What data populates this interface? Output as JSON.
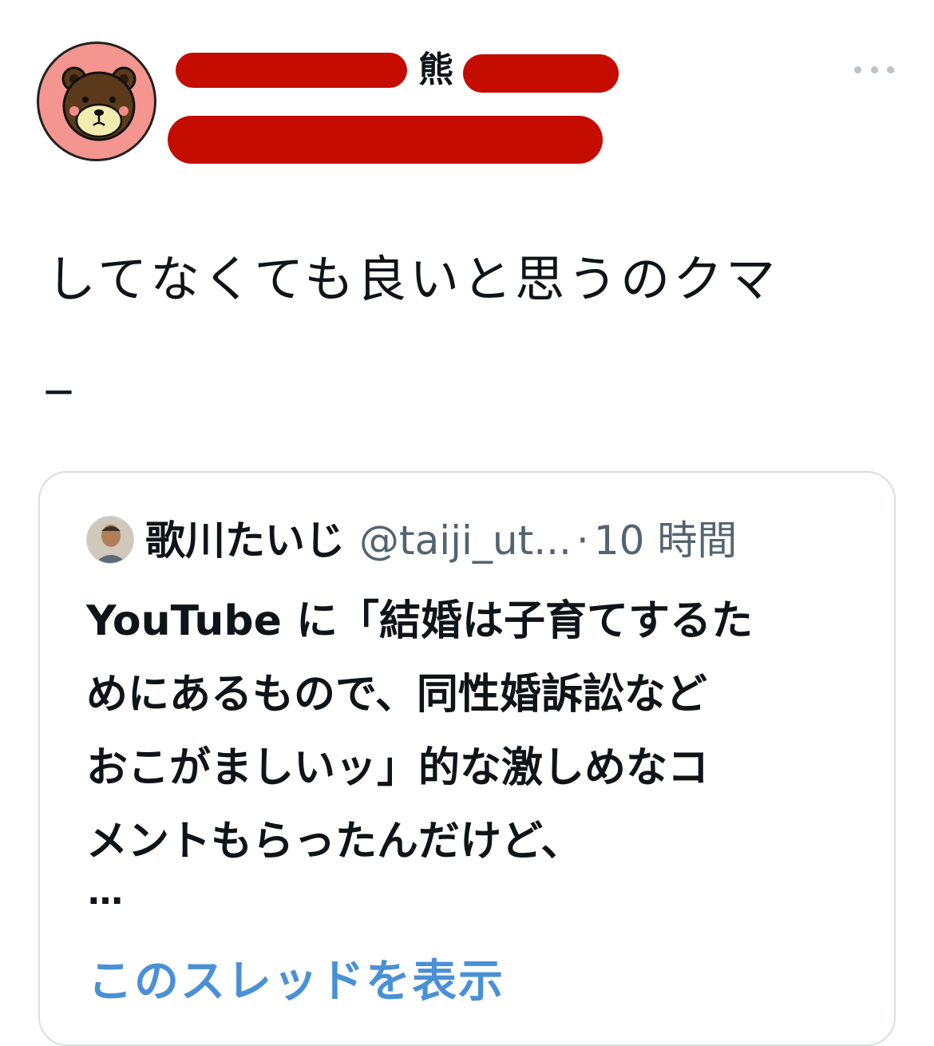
{
  "author": {
    "name_visible_fragment": "熊",
    "avatar_icon": "bear-face-icon",
    "redacted": true
  },
  "more_menu": {
    "icon": "more-horizontal-icon"
  },
  "tweet": {
    "text": "してなくても良いと思うのクマ\n_"
  },
  "quote": {
    "author_name": "歌川たいじ",
    "author_handle": "@taiji_ut...",
    "separator": "·",
    "time": "10 時間",
    "text": "YouTube に「結婚は子育てするた\nめにあるもので、同性婚訴訟など\nおこがましいッ」的な激しめなコ\nメントもらったんだけど、",
    "ellipsis": "…",
    "show_thread": "このスレッドを表示"
  },
  "colors": {
    "redaction": "#c40c00",
    "avatar_bg": "#f4958f",
    "link": "#4a90d6",
    "secondary": "#536471",
    "border": "#d9dee3"
  }
}
